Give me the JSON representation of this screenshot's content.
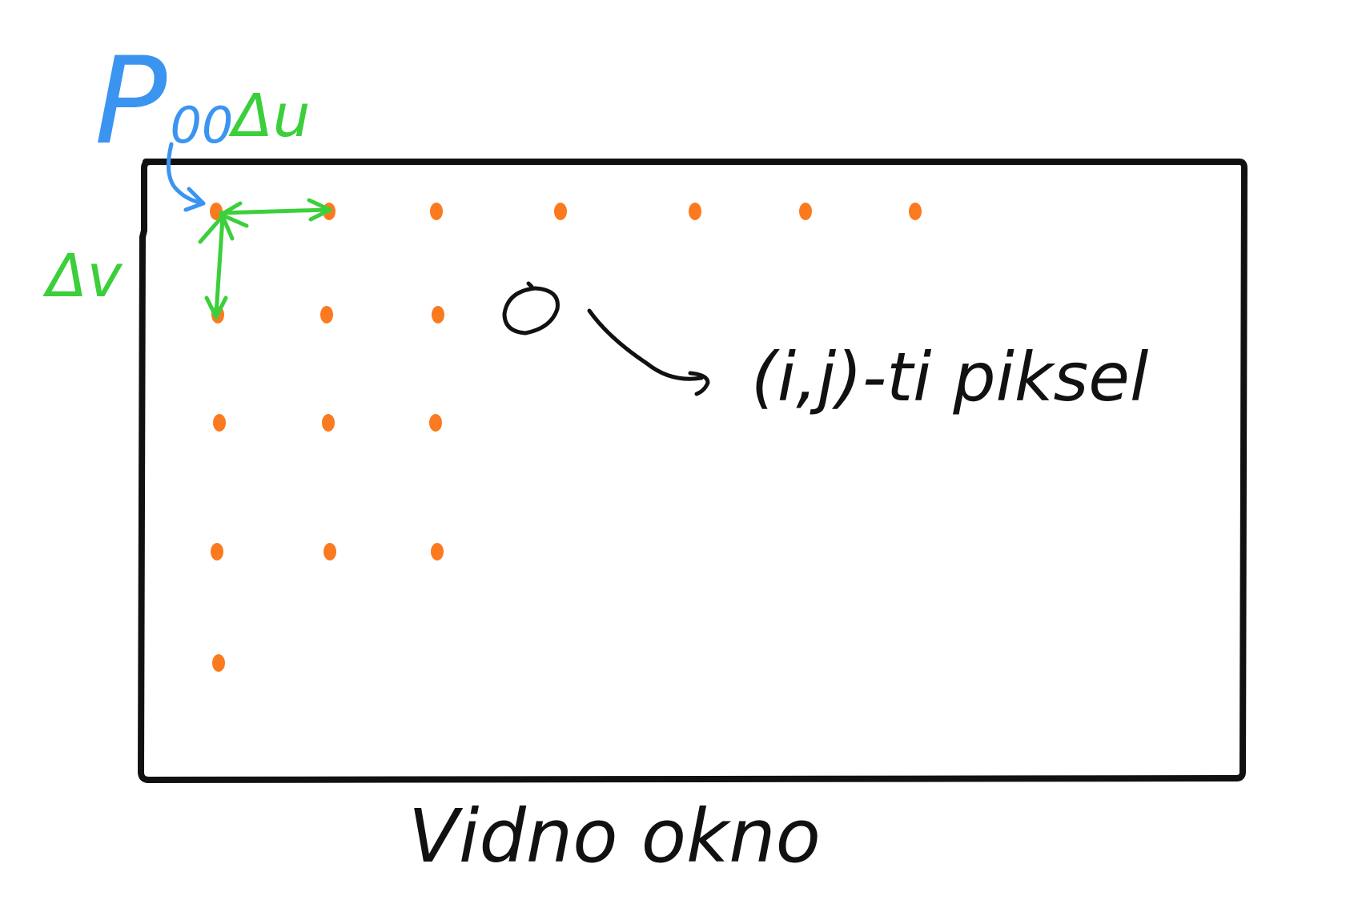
{
  "labels": {
    "origin_pixel_main": "P",
    "origin_pixel_sub": "00",
    "horizontal_step": "Δu",
    "vertical_step": "Δv",
    "highlighted_pixel": "(i,j)-ti piksel",
    "viewport_caption": "Vidno okno"
  },
  "pixel_grid": {
    "row_counts": [
      7,
      3,
      3,
      3,
      1
    ],
    "highlighted_row": 1,
    "highlighted_col": 3
  },
  "colors": {
    "frame": "#111111",
    "pixel_dot": "#fb7a1f",
    "step_arrow": "#3ccf3c",
    "origin_label": "#3a94f0",
    "annotation": "#111111"
  }
}
